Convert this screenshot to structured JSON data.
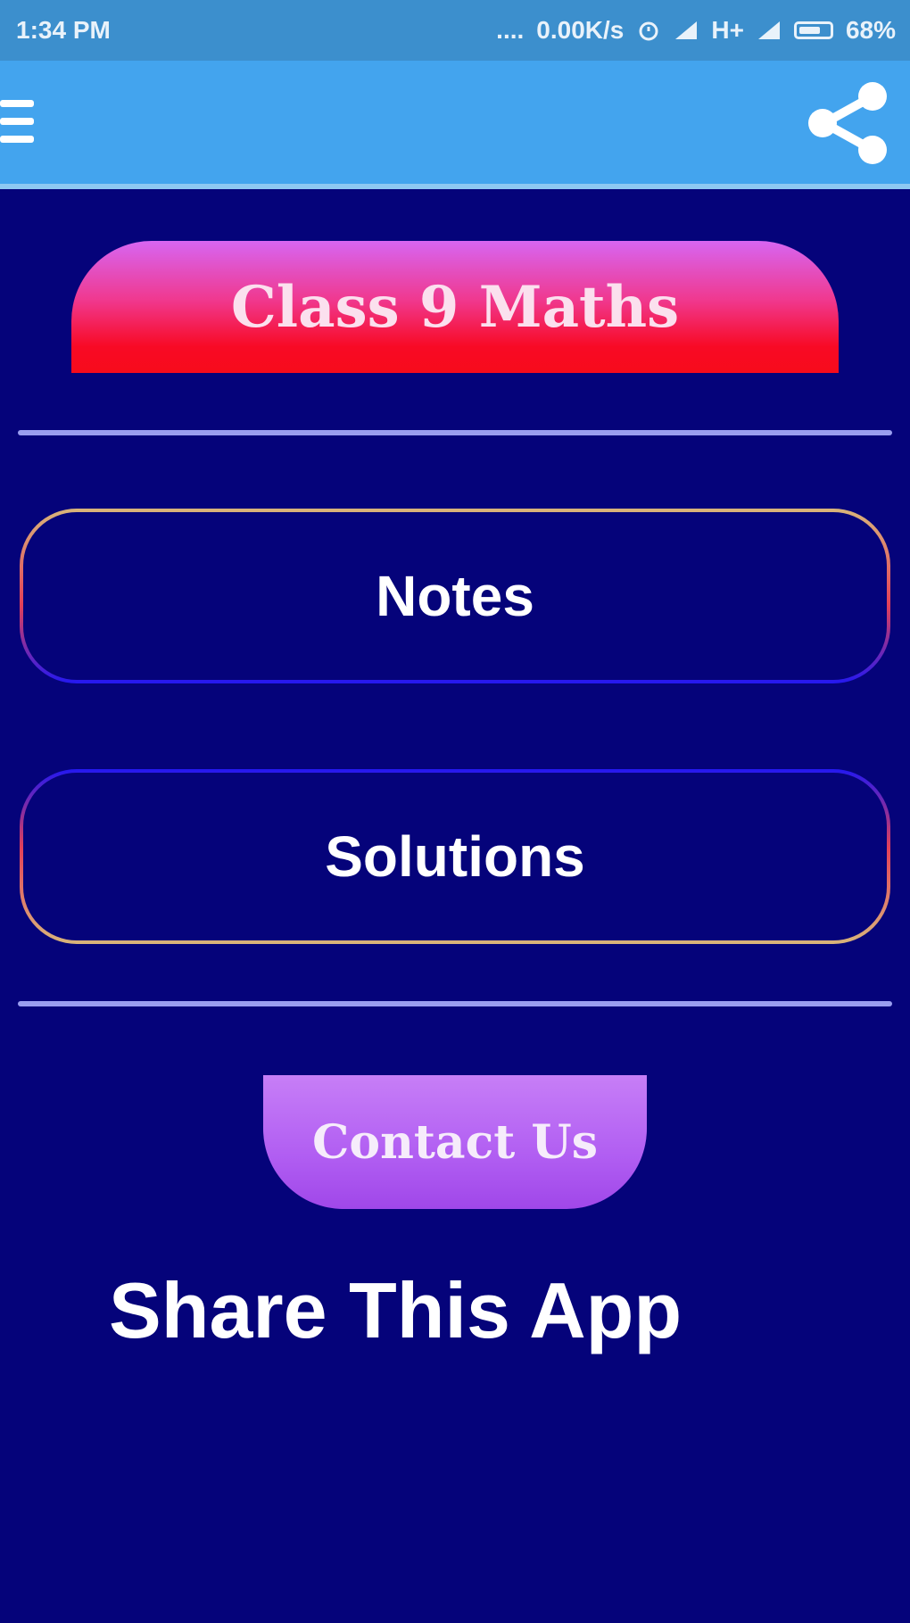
{
  "status_bar": {
    "time": "1:34 PM",
    "dots": "....",
    "speed": "0.00K/s",
    "network": "H+",
    "battery": "68%"
  },
  "app_bar": {
    "menu_icon": "hamburger-menu-icon",
    "share_icon": "share-icon"
  },
  "main": {
    "title": "Class 9 Maths",
    "notes_label": "Notes",
    "solutions_label": "Solutions",
    "contact_label": "Contact Us",
    "share_label": "Share This App"
  },
  "colors": {
    "background": "#05037a",
    "app_bar": "#43a4ee",
    "status_bar": "#3c8fcd",
    "title_red": "#f80a25",
    "contact_purple": "#b15ef2"
  }
}
